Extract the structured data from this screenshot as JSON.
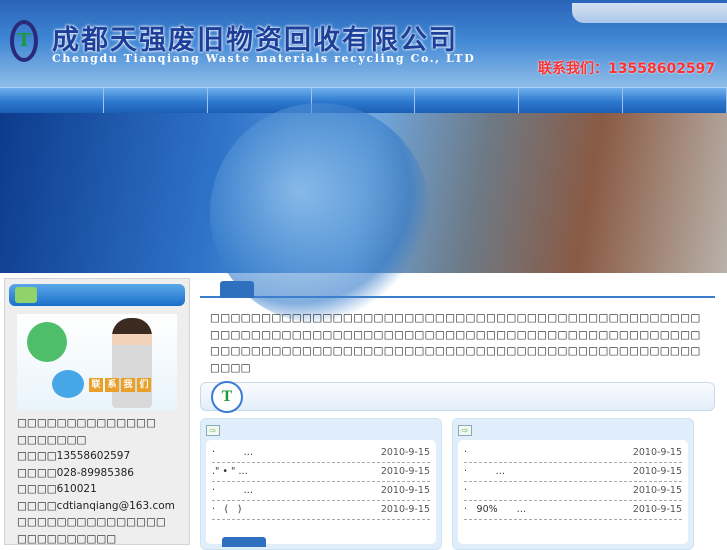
{
  "header": {
    "logo": "T",
    "title": "成都天强废旧物资回收有限公司",
    "subtitle": "Chengdu Tianqiang Waste materials recycling Co., LTD",
    "contact": "联系我们：13558602597"
  },
  "left": {
    "contact_tag": [
      "联",
      "系",
      "我",
      "们"
    ],
    "info": [
      "□□□□□□□□□□□□□□",
      "□□□□□□□",
      "□□□□13558602597",
      "□□□□028-89985386",
      "□□□□610021",
      "□□□□cdtianqiang@163.com",
      "□□□□□□□□□□□□□□□",
      "□□□□□□□□□□"
    ]
  },
  "main": {
    "intro": "□□□□□□□□□□□□□□□□□□□□□□□□□□□□□□□□□□□□□□□□□□□□□□□□□□□□□□□□□□□□□□□□□□□□□□□□□□□□□□□□□□□□□□□□□□□□□□□□□□□□□□□□□□□□□□□□□□□□□□□□□□□□□□□□□□□□□□□□□□□□□□□□□□□□",
    "news_left": [
      {
        "t": "·　　　…",
        "d": "2010-9-15"
      },
      {
        "t": ".\" • \" …",
        "d": "2010-9-15"
      },
      {
        "t": "·　　　…",
        "d": "2010-9-15"
      },
      {
        "t": "·　(　)",
        "d": "2010-9-15"
      }
    ],
    "news_right": [
      {
        "t": "·",
        "d": "2010-9-15"
      },
      {
        "t": "·　　　…",
        "d": "2010-9-15"
      },
      {
        "t": "·",
        "d": "2010-9-15"
      },
      {
        "t": "·　90%　　…",
        "d": "2010-9-15"
      }
    ]
  }
}
